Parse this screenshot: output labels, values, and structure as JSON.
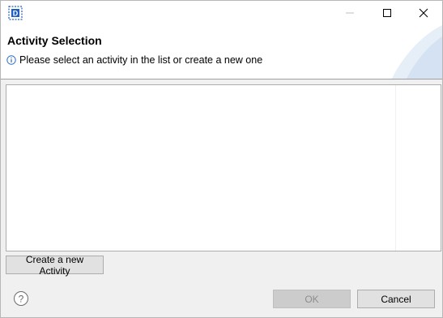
{
  "window": {
    "icon": "app-d-icon"
  },
  "header": {
    "title": "Activity Selection",
    "message": "Please select an activity in the list or create a new one",
    "message_icon": "info-icon"
  },
  "list": {
    "items": []
  },
  "buttons": {
    "create_label": "Create a new Activity",
    "ok_label": "OK",
    "cancel_label": "Cancel"
  },
  "footer": {
    "help_icon": "help-icon"
  },
  "colors": {
    "accent": "#1f5fbf",
    "dialog_bg": "#f0f0f0"
  }
}
